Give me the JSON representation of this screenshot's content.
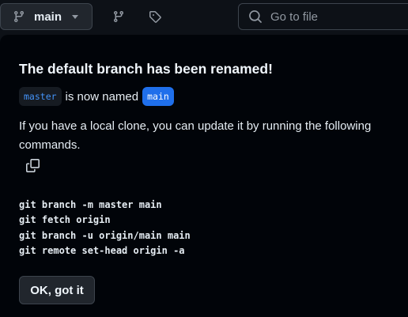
{
  "toolbar": {
    "branch_label": "main",
    "branch_icon": "git-branch-icon",
    "branches_icon": "git-branch-icon",
    "tags_icon": "tag-icon",
    "search": {
      "placeholder": "Go to file",
      "value": "",
      "icon": "search-icon"
    }
  },
  "popover": {
    "title": "The default branch has been renamed!",
    "old_branch": "master",
    "rename_text": "is now named",
    "new_branch": "main",
    "description": "If you have a local clone, you can update it by running the following commands.",
    "copy_icon": "copy-icon",
    "commands": [
      "git branch -m master main",
      "git fetch origin",
      "git branch -u origin/main main",
      "git remote set-head origin -a"
    ],
    "ok_label": "OK, got it"
  },
  "colors": {
    "background": "#0d1117",
    "popover_background": "#010409",
    "button_background": "#21262d",
    "accent_blue": "#1f6feb",
    "link_blue": "#4493f8",
    "muted": "#9198a1"
  }
}
